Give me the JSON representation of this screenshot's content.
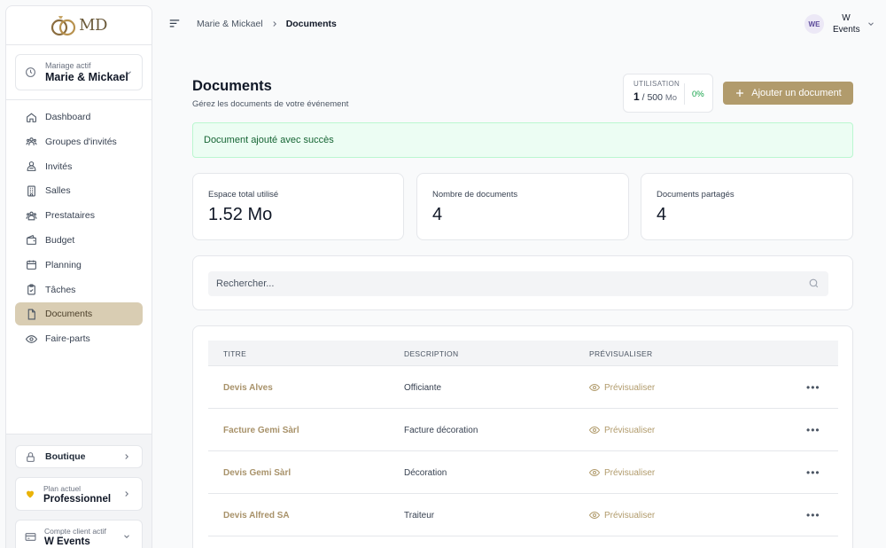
{
  "app": {
    "logo_text": "MD"
  },
  "sidebar": {
    "wedding": {
      "label": "Mariage actif",
      "value": "Marie & Mickael"
    },
    "items": [
      {
        "label": "Dashboard",
        "icon": "home-icon"
      },
      {
        "label": "Groupes d'invités",
        "icon": "groups-icon"
      },
      {
        "label": "Invités",
        "icon": "users-icon"
      },
      {
        "label": "Salles",
        "icon": "building-icon"
      },
      {
        "label": "Prestataires",
        "icon": "vendors-icon"
      },
      {
        "label": "Budget",
        "icon": "budget-icon"
      },
      {
        "label": "Planning",
        "icon": "calendar-icon"
      },
      {
        "label": "Tâches",
        "icon": "clipboard-icon"
      },
      {
        "label": "Documents",
        "icon": "document-icon",
        "active": true
      },
      {
        "label": "Faire-parts",
        "icon": "eye-icon"
      }
    ],
    "boutique": "Boutique",
    "plan": {
      "label": "Plan actuel",
      "value": "Professionnel"
    },
    "client": {
      "label": "Compte client actif",
      "value": "W Events"
    }
  },
  "header": {
    "breadcrumb": [
      "Marie & Mickael",
      "Documents"
    ],
    "user": {
      "initials": "WE",
      "name_line1": "W",
      "name_line2": "Events"
    }
  },
  "main": {
    "title": "Documents",
    "subtitle": "Gérez les documents de votre événement",
    "usage": {
      "label": "UTILISATION",
      "used": "1",
      "total": "/ 500",
      "unit": "Mo",
      "percent": "0%"
    },
    "add_button": "Ajouter un document",
    "alert": "Document ajouté avec succès",
    "stats": [
      {
        "label": "Espace total utilisé",
        "value": "1.52 Mo"
      },
      {
        "label": "Nombre de documents",
        "value": "4"
      },
      {
        "label": "Documents partagés",
        "value": "4"
      }
    ],
    "search": {
      "placeholder": "Rechercher..."
    },
    "table": {
      "headers": [
        "TITRE",
        "DESCRIPTION",
        "PRÉVISUALISER"
      ],
      "preview_label": "Prévisualiser",
      "rows": [
        {
          "title": "Devis Alves",
          "description": "Officiante"
        },
        {
          "title": "Facture Gemi Sàrl",
          "description": "Facture décoration"
        },
        {
          "title": "Devis Gemi Sàrl",
          "description": "Décoration"
        },
        {
          "title": "Devis Alfred SA",
          "description": "Traiteur"
        }
      ]
    }
  },
  "colors": {
    "accent": "#b19b6c",
    "active_nav": "#d9cdb3",
    "success": "#16a34a",
    "alert_bg": "#ecfdf3"
  }
}
